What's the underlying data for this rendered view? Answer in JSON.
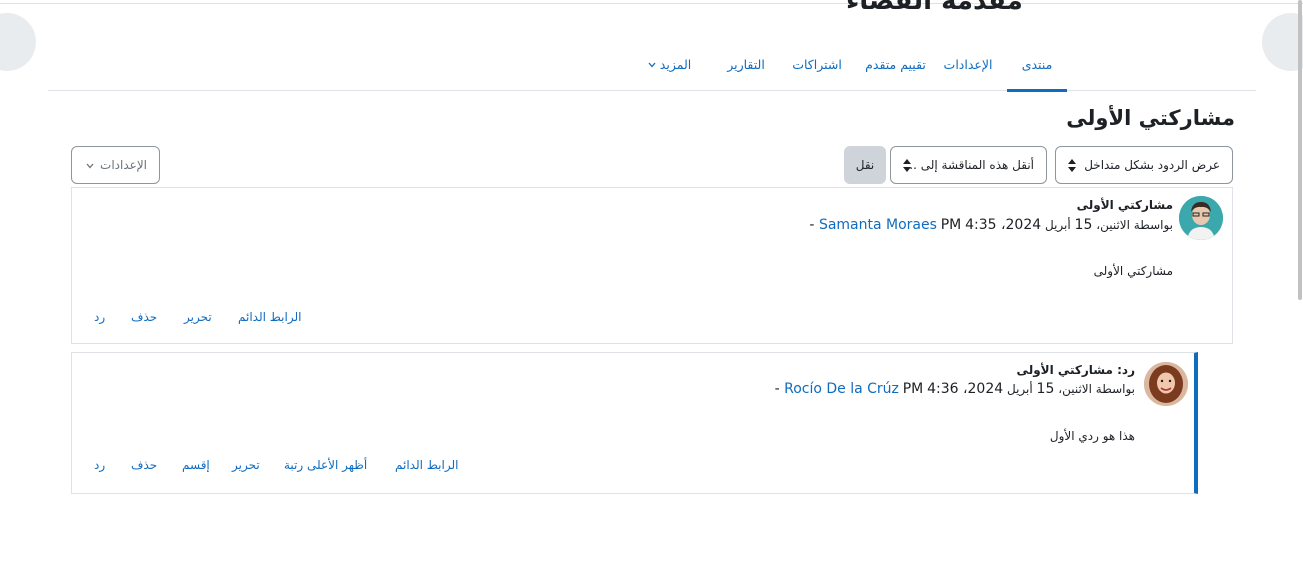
{
  "course": {
    "title": "مقدمة الفضاء"
  },
  "secondary_nav": {
    "items": [
      {
        "label": "منتدى",
        "active": true
      },
      {
        "label": "الإعدادات"
      },
      {
        "label": "تقييم متقدم"
      },
      {
        "label": "اشتراكات"
      },
      {
        "label": "التقارير"
      },
      {
        "label": "المزيد"
      }
    ]
  },
  "discussion": {
    "title": "مشاركتي الأولى",
    "display_mode": "عرض الردود بشكل متداخل",
    "move_select": "أنقل هذه المناقشة إلى ...",
    "move_button": "نقل",
    "settings_dropdown": "الإعدادات"
  },
  "posts": [
    {
      "title": "مشاركتي الأولى",
      "byline_prefix": "بواسطة الاثنين،",
      "day": "15",
      "month": "أبريل",
      "year_time": "2024، 4:35",
      "separator": "PM -",
      "author": "Samanta Moraes",
      "content": "مشاركتي الأولى",
      "actions": [
        "الرابط الدائم",
        "تحرير",
        "حذف",
        "رد"
      ]
    },
    {
      "title": "رد: مشاركتي الأولى",
      "byline_prefix": "بواسطة الاثنين،",
      "day": "15",
      "month": "أبريل",
      "year_time": "2024، 4:36",
      "separator": "PM -",
      "author": "Rocío De la Crúz",
      "content": "هذا هو ردي الأول",
      "actions": [
        "الرابط الدائم",
        "أظهر الأعلى رتبة",
        "تحرير",
        "إقسم",
        "حذف",
        "رد"
      ]
    }
  ],
  "colors": {
    "link": "#0f6cbf",
    "border": "#dee2e6",
    "thread_indicator": "#0f6cbf"
  },
  "icons": {
    "left_drawer": "chevron-right-icon",
    "right_drawer": "list-icon"
  }
}
